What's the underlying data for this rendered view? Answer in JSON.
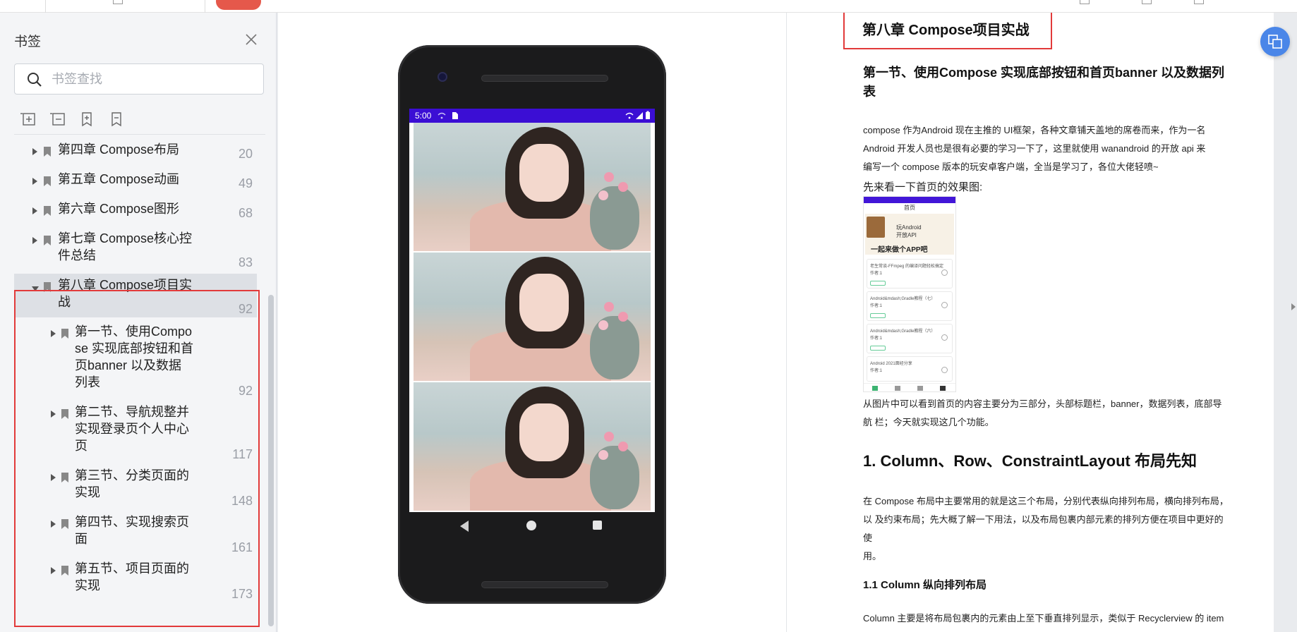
{
  "sidebar": {
    "title": "书签",
    "search_placeholder": "书签查找",
    "tools": [
      "add-bookmark-icon",
      "remove-bookmark-icon",
      "bookmark-insert-icon",
      "bookmark-icon"
    ],
    "items": [
      {
        "label": "第四章 Compose布局",
        "page": "20"
      },
      {
        "label": "第五章 Compose动画",
        "page": "49"
      },
      {
        "label": "第六章 Compose图形",
        "page": "68"
      },
      {
        "label_line1": "第七章 Compose核心控",
        "label_line2": "件总结",
        "page": "83"
      },
      {
        "label_line1": "第八章 Compose项目实",
        "label_line2": "战",
        "page": "92"
      },
      {
        "line1": "第一节、使用Compo",
        "line2": "se 实现底部按钮和首",
        "line3": "页banner 以及数据",
        "line4": "列表",
        "page": "92"
      },
      {
        "line1": "第二节、导航规整并",
        "line2": "实现登录页个人中心",
        "line3": "页",
        "page": "117"
      },
      {
        "line1": "第三节、分类页面的",
        "line2": "实现",
        "page": "148"
      },
      {
        "line1": "第四节、实现搜索页",
        "line2": "面",
        "page": "161"
      },
      {
        "line1": "第五节、项目页面的",
        "line2": "实现",
        "page": "173"
      }
    ]
  },
  "phone": {
    "time": "5:00"
  },
  "right": {
    "chapter_title": "第八章 Compose项目实战",
    "section_title_1": "第一节、使用Compose 实现底部按钮和首页banner 以及数据列",
    "section_title_2": "表",
    "p1_l1": "compose 作为Android 现在主推的 UI框架，各种文章铺天盖地的席卷而来，作为一名",
    "p1_l2": "Android 开发人员也是很有必要的学习一下了，这里就使用 wanandroid 的开放 api 来",
    "p1_l3": "编写一个 compose 版本的玩安卓客户端，全当是学习了，各位大佬轻喷~",
    "intro": "先来看一下首页的效果图:",
    "shot": {
      "title": "首页",
      "banner_text1": "玩Android",
      "banner_text2": "开放API",
      "banner_slogan": "一起来做个APP吧",
      "cards": [
        {
          "title": "老生常谈-FFmpeg 的编译问题轻松搞定",
          "author": "作者:1"
        },
        {
          "title": "Android&mdash;Gradle教程（七）",
          "author": "作者:1"
        },
        {
          "title": "Android&mdash;Gradle教程（六）",
          "author": "作者:1"
        },
        {
          "title": "Android 2021面经分享",
          "author": "作者:1"
        }
      ]
    },
    "p2_l1": "从图片中可以看到首页的内容主要分为三部分，头部标题栏，banner，数据列表，底部导",
    "p2_l2": "航 栏；今天就实现这几个功能。",
    "h1": "1. Column、Row、ConstraintLayout 布局先知",
    "p3_l1": "在 Compose 布局中主要常用的就是这三个布局，分别代表纵向排列布局，横向排列布局，",
    "p3_l2": "以 及约束布局；先大概了解一下用法，以及布局包裹内部元素的排列方便在项目中更好的使",
    "p3_l3": "用。",
    "h2": "1.1 Column 纵向排列布局",
    "p4_l1": "Column 主要是将布局包裹内的元素由上至下垂直排列显示，类似于 Recyclerview 的 item"
  },
  "colors": {
    "highlight_red": "#e23a3a",
    "status_bar": "#3b0ed4",
    "float_button": "#4a86e8"
  }
}
